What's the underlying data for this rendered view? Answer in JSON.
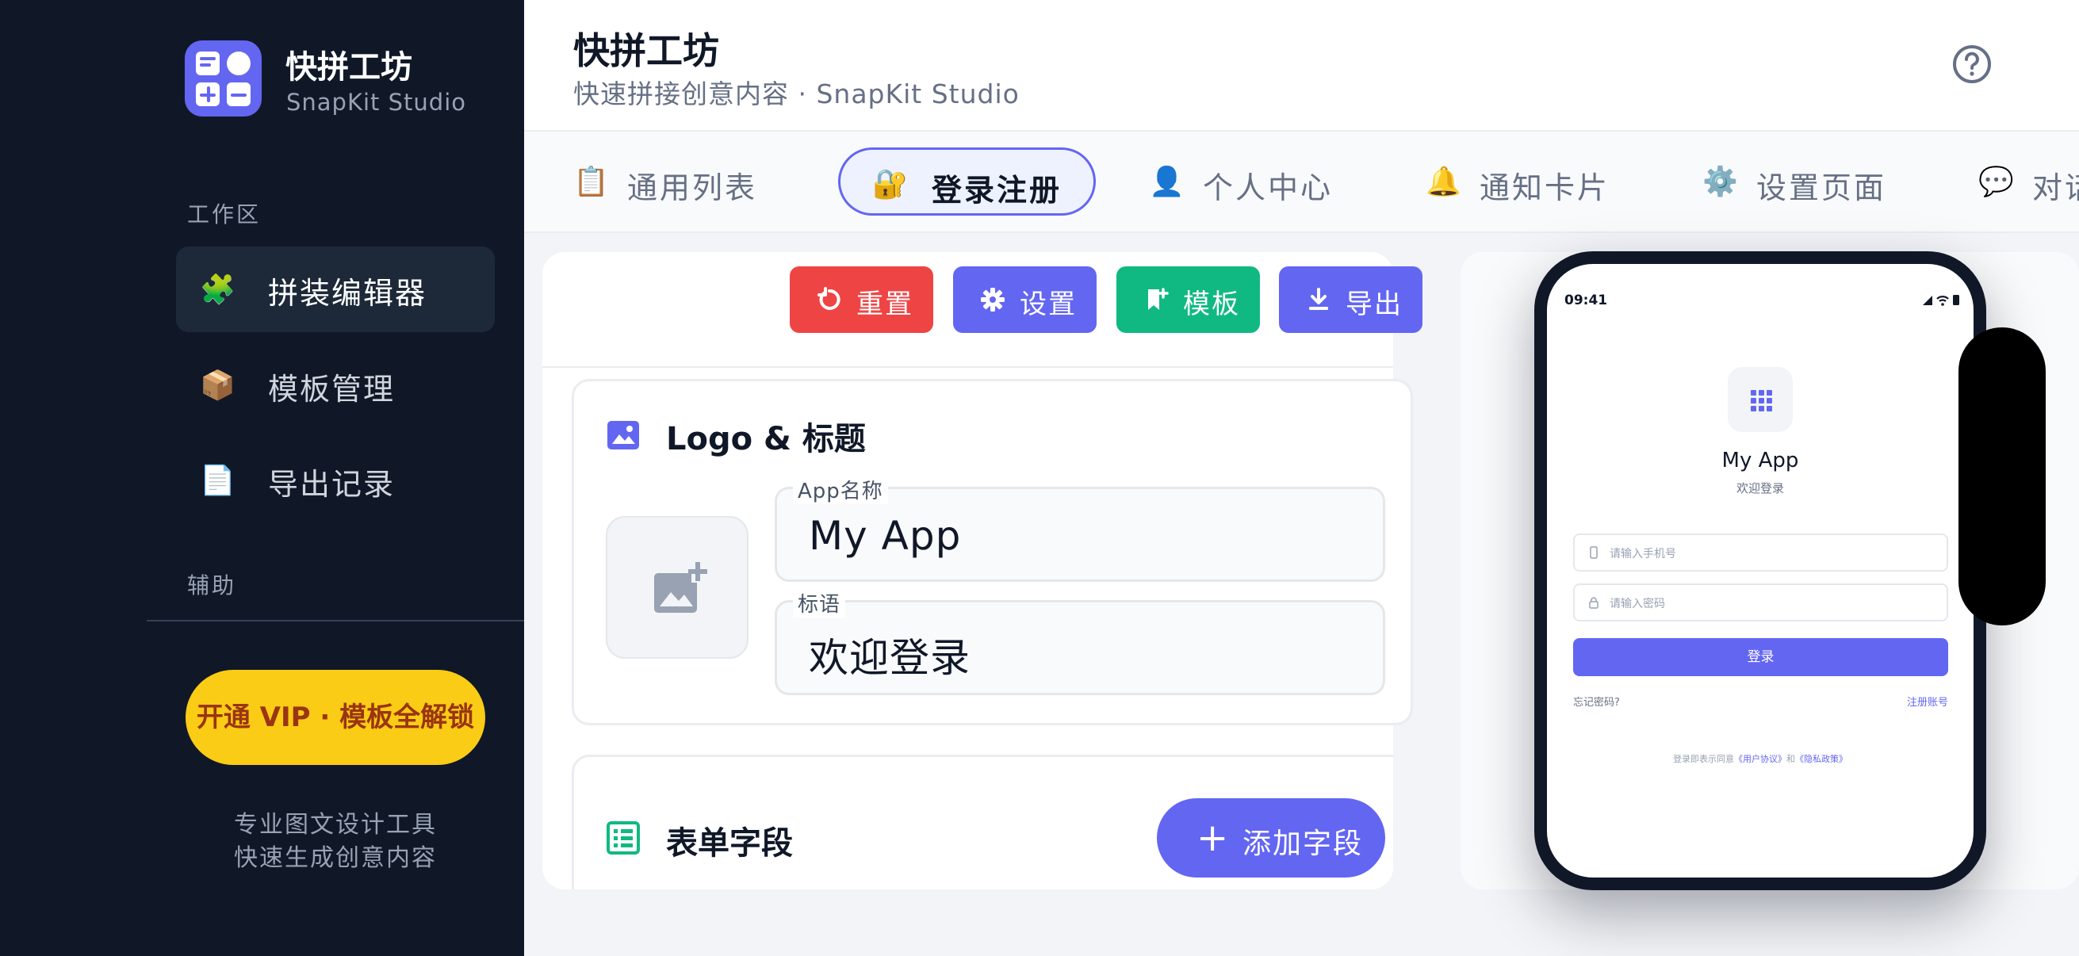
{
  "brand": {
    "name": "快拼工坊",
    "subtitle": "SnapKit Studio"
  },
  "sidebar": {
    "section_workspace": "工作区",
    "items": [
      {
        "label": "拼装编辑器",
        "icon": "puzzle-icon",
        "active": true
      },
      {
        "label": "模板管理",
        "icon": "package-icon",
        "active": false
      },
      {
        "label": "导出记录",
        "icon": "document-icon",
        "active": false
      }
    ],
    "section_aux": "辅助",
    "vip_button": "开通 VIP · 模板全解锁",
    "tagline_1": "专业图文设计工具",
    "tagline_2": "快速生成创意内容"
  },
  "header": {
    "title": "快拼工坊",
    "subtitle": "快速拼接创意内容 · SnapKit Studio",
    "help_icon": "help-circle-icon"
  },
  "tabs": [
    {
      "label": "通用列表",
      "icon": "clipboard-icon",
      "active": false
    },
    {
      "label": "登录注册",
      "icon": "lock-key-icon",
      "active": true
    },
    {
      "label": "个人中心",
      "icon": "user-icon",
      "active": false
    },
    {
      "label": "通知卡片",
      "icon": "bell-icon",
      "active": false
    },
    {
      "label": "设置页面",
      "icon": "gear-icon",
      "active": false
    },
    {
      "label": "对话",
      "icon": "chat-bubble-icon",
      "active": false
    }
  ],
  "toolbar": {
    "reset_label": "重置",
    "settings_label": "设置",
    "template_label": "模板",
    "export_label": "导出",
    "colors": {
      "reset": "#ef4444",
      "settings": "#6366f1",
      "template": "#10b981",
      "export": "#6366f1"
    }
  },
  "logo_section": {
    "title": "Logo & 标题",
    "app_name_label": "App名称",
    "app_name_value": "My App",
    "slogan_label": "标语",
    "slogan_value": "欢迎登录"
  },
  "form_section": {
    "title": "表单字段",
    "add_button": "添加字段"
  },
  "preview": {
    "time": "09:41",
    "app_name": "My App",
    "slogan": "欢迎登录",
    "phone_placeholder": "请输入手机号",
    "password_placeholder": "请输入密码",
    "login_button": "登录",
    "forgot": "忘记密码?",
    "register": "注册账号",
    "terms_prefix": "登录即表示同意",
    "terms_user": "《用户协议》",
    "terms_and": "和",
    "terms_privacy": "《隐私政策》"
  },
  "colors": {
    "accent": "#6366f1",
    "sidebar_bg": "#101828",
    "vip": "#facc15"
  }
}
